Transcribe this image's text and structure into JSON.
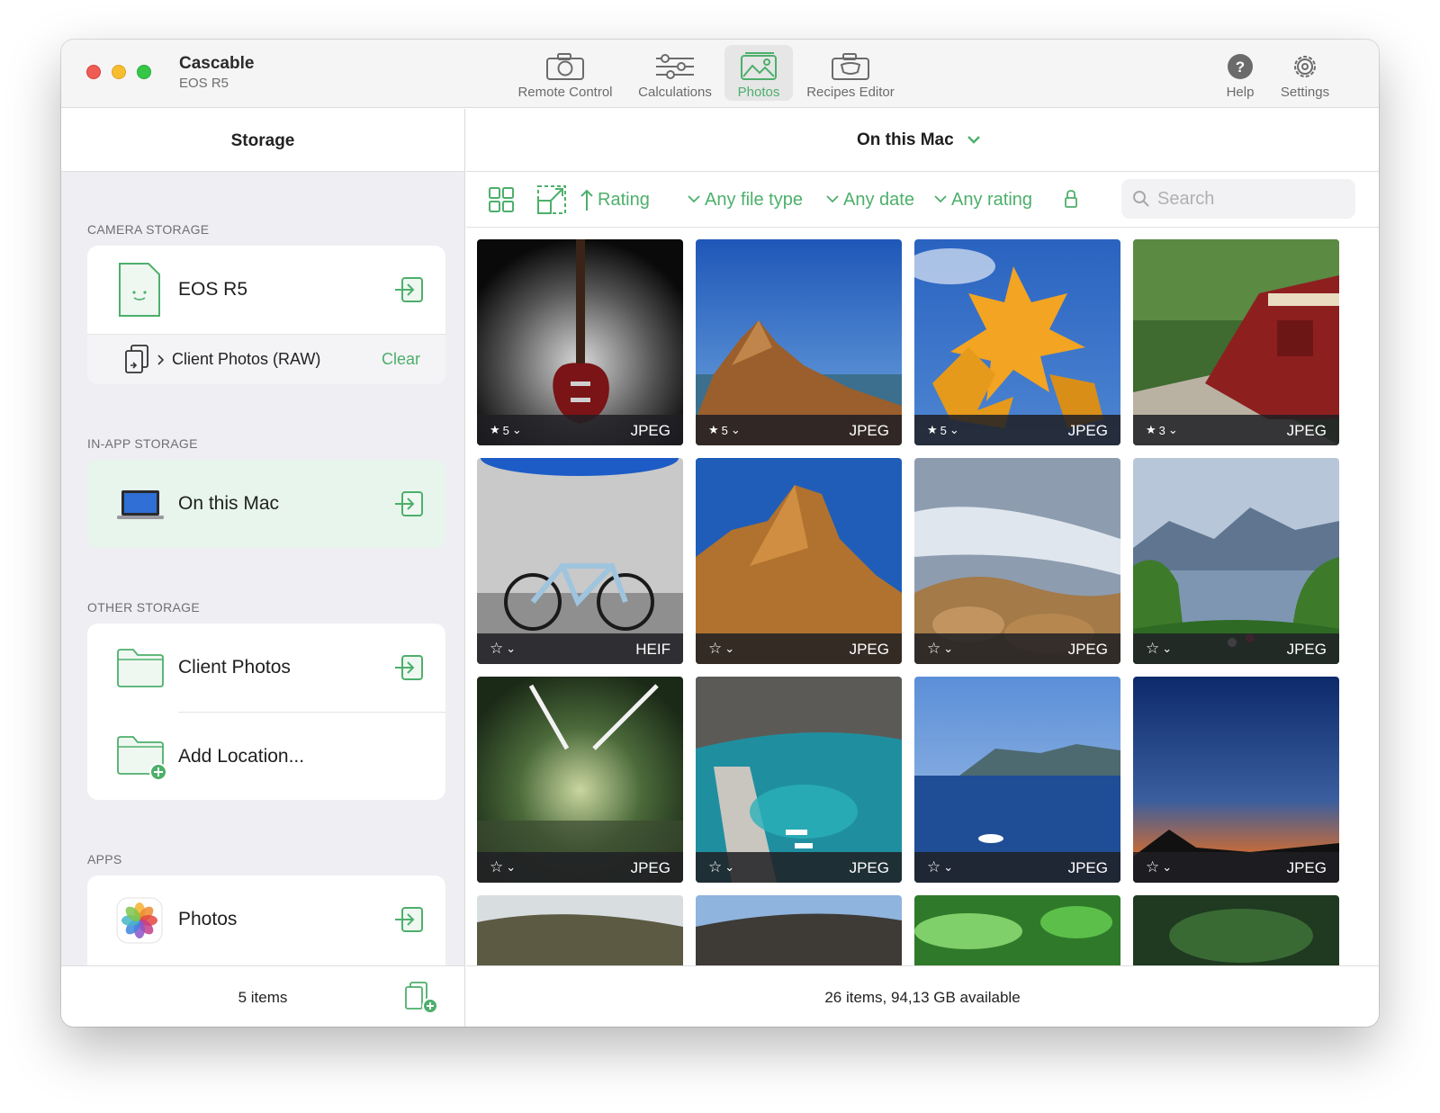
{
  "window": {
    "app_title": "Cascable",
    "app_subtitle": "EOS R5"
  },
  "toolbar": {
    "items": [
      {
        "label": "Remote Control",
        "icon": "camera-icon",
        "active": false
      },
      {
        "label": "Calculations",
        "icon": "sliders-icon",
        "active": false
      },
      {
        "label": "Photos",
        "icon": "photos-icon",
        "active": true
      },
      {
        "label": "Recipes Editor",
        "icon": "recipes-icon",
        "active": false
      },
      {
        "label": "Help",
        "icon": "help-icon",
        "active": false
      },
      {
        "label": "Settings",
        "icon": "gear-icon",
        "active": false
      }
    ]
  },
  "sidebar": {
    "title": "Storage",
    "camera_section": "CAMERA STORAGE",
    "camera_name": "EOS R5",
    "camera_folder": "Client Photos (RAW)",
    "camera_folder_action": "Clear",
    "inapp_section": "IN-APP STORAGE",
    "inapp_name": "On this Mac",
    "other_section": "OTHER STORAGE",
    "other_items": [
      "Client Photos",
      "Add Location..."
    ],
    "apps_section": "APPS",
    "apps_items": [
      "Photos"
    ],
    "footer": "5 items"
  },
  "main": {
    "location": "On this Mac",
    "sort_label": "Rating",
    "filters": {
      "file_type": "Any file type",
      "date": "Any date",
      "rating": "Any rating"
    },
    "search_placeholder": "Search",
    "footer": "26 items, 94,13 GB available"
  },
  "photos": [
    {
      "rating": "5",
      "type": "JPEG",
      "subject": "guitar"
    },
    {
      "rating": "5",
      "type": "JPEG",
      "subject": "coast-rock"
    },
    {
      "rating": "5",
      "type": "JPEG",
      "subject": "autumn-leaves"
    },
    {
      "rating": "3",
      "type": "JPEG",
      "subject": "train"
    },
    {
      "rating": "",
      "type": "HEIF",
      "subject": "bicycle"
    },
    {
      "rating": "",
      "type": "JPEG",
      "subject": "rock-formation"
    },
    {
      "rating": "",
      "type": "JPEG",
      "subject": "water-rocks"
    },
    {
      "rating": "",
      "type": "JPEG",
      "subject": "lake-mountains"
    },
    {
      "rating": "",
      "type": "JPEG",
      "subject": "tunnel"
    },
    {
      "rating": "",
      "type": "JPEG",
      "subject": "harbor"
    },
    {
      "rating": "",
      "type": "JPEG",
      "subject": "sea-boat"
    },
    {
      "rating": "",
      "type": "JPEG",
      "subject": "sunset-silhouette"
    },
    {
      "rating": "",
      "type": "",
      "subject": "landscape-hills"
    },
    {
      "rating": "",
      "type": "",
      "subject": "coast-cliffs"
    },
    {
      "rating": "",
      "type": "",
      "subject": "green-leaves"
    },
    {
      "rating": "",
      "type": "",
      "subject": "dark-leaf"
    }
  ],
  "colors": {
    "accent": "#4daf6b",
    "sidebar_bg": "#eeeef3",
    "selected_row": "#e7f5ec"
  }
}
